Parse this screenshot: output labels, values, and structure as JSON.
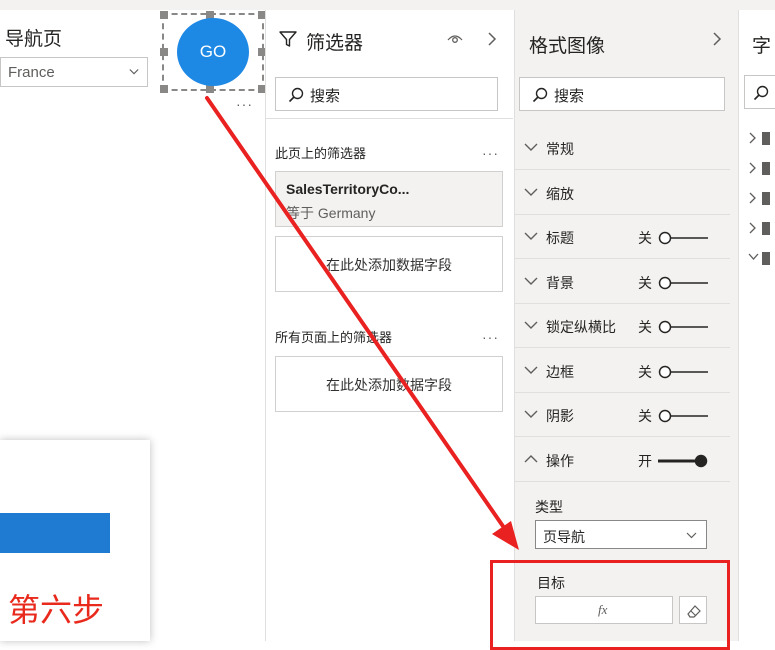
{
  "canvas": {
    "nav_title": "导航页",
    "dropdown_value": "France",
    "go_button_label": "GO",
    "more_dots": "···",
    "popup_step_text": "第六步"
  },
  "filter_panel": {
    "title": "筛选器",
    "search_placeholder": "搜索",
    "page_filters_label": "此页上的筛选器",
    "page_filters_more": "···",
    "filter_card_field": "SalesTerritoryCo...",
    "filter_card_condition": "等于 Germany",
    "add_field_1": "在此处添加数据字段",
    "all_pages_label": "所有页面上的筛选器",
    "all_pages_more": "···",
    "add_field_2": "在此处添加数据字段"
  },
  "format_panel": {
    "title": "格式图像",
    "search_placeholder": "搜索",
    "rows": [
      {
        "label": "常规",
        "state": "",
        "expanded": false
      },
      {
        "label": "缩放",
        "state": "",
        "expanded": false
      },
      {
        "label": "标题",
        "state": "关",
        "expanded": false
      },
      {
        "label": "背景",
        "state": "关",
        "expanded": false
      },
      {
        "label": "锁定纵横比",
        "state": "关",
        "expanded": false
      },
      {
        "label": "边框",
        "state": "关",
        "expanded": false
      },
      {
        "label": "阴影",
        "state": "关",
        "expanded": false
      },
      {
        "label": "操作",
        "state": "开",
        "expanded": true
      }
    ],
    "type_label": "类型",
    "type_value": "页导航",
    "target_label": "目标",
    "fx_label": "fx"
  },
  "fields_panel": {
    "title_partial": "字"
  },
  "colors": {
    "accent_blue": "#1e88e5",
    "annotation_red": "#ea2121",
    "panel_bg": "#f3f2f1"
  }
}
